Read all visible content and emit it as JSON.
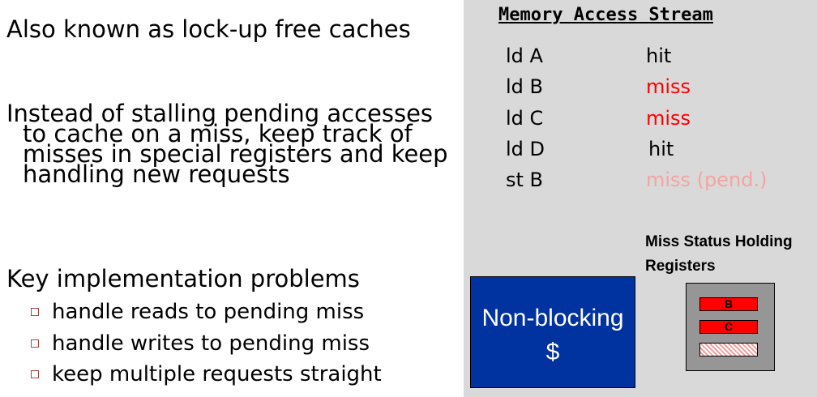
{
  "left": {
    "intro": "Also known as lock-up free caches",
    "para_lines": [
      "Instead of stalling pending accesses",
      "to cache on a miss, keep track of",
      "misses in special registers and keep",
      "handling new requests"
    ],
    "key_heading": "Key implementation problems",
    "bullets": [
      "handle reads to pending miss",
      "handle writes to pending miss",
      "keep multiple requests straight"
    ]
  },
  "stream": {
    "title": "Memory Access Stream",
    "rows": [
      {
        "op": "ld A",
        "result": "hit",
        "status": "hit"
      },
      {
        "op": "ld B",
        "result": "miss",
        "status": "miss"
      },
      {
        "op": "ld C",
        "result": "miss",
        "status": "miss"
      },
      {
        "op": "ld D",
        "result": "hit",
        "status": "hit"
      },
      {
        "op": "st B",
        "result": "miss (pend.)",
        "status": "pending"
      }
    ]
  },
  "cache": {
    "line1": "Non-blocking",
    "line2": "$"
  },
  "mshr": {
    "label_line1": "Miss Status Holding",
    "label_line2": "Registers",
    "entries": [
      "B",
      "C",
      ""
    ]
  },
  "colors": {
    "panel": "#d9d9d9",
    "cache_box": "#0033a0",
    "miss": "#ff0000",
    "pending": "#f4a4a4",
    "mshr_box": "#969696"
  }
}
